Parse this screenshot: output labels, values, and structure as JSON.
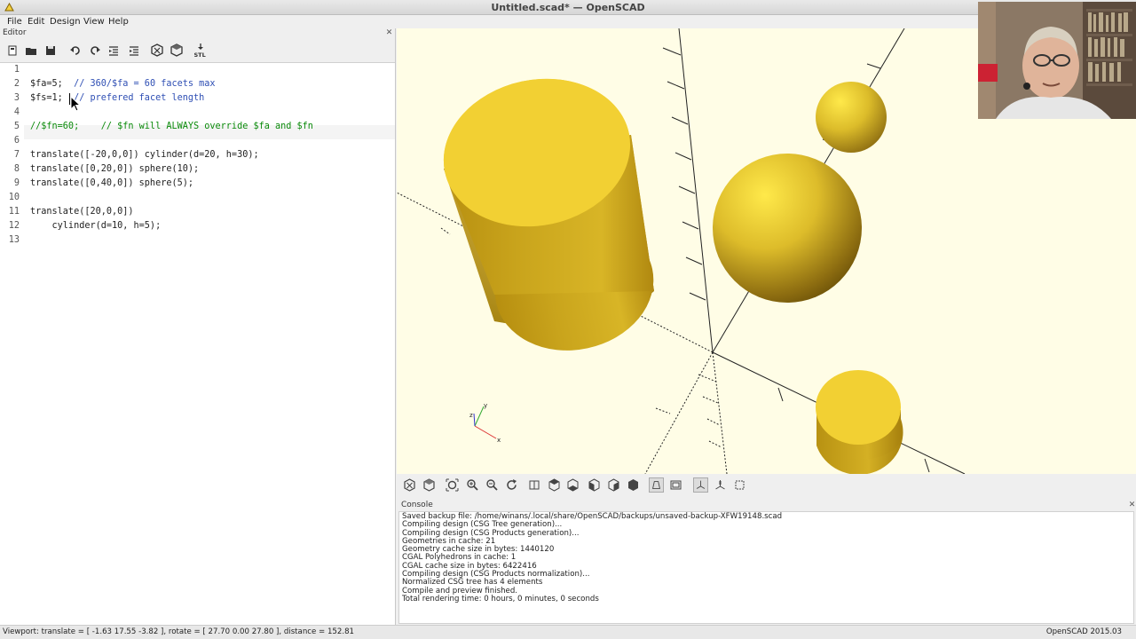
{
  "window": {
    "title": "Untitled.scad* — OpenSCAD"
  },
  "menu": [
    "File",
    "Edit",
    "Design",
    "View",
    "Help"
  ],
  "editor": {
    "dock_title": "Editor",
    "toolbar_icons": [
      "new-file-icon",
      "open-file-icon",
      "save-file-icon",
      "undo-icon",
      "redo-icon",
      "unindent-icon",
      "indent-icon",
      "preview-icon",
      "render-icon",
      "export-stl-icon"
    ],
    "stl_label": "STL",
    "line_numbers": [
      "1",
      "2",
      "3",
      "4",
      "5",
      "6",
      "7",
      "8",
      "9",
      "10",
      "11",
      "12",
      "13"
    ],
    "lines": [
      {
        "code": "",
        "comment": ""
      },
      {
        "code": "$fa=5;  ",
        "comment": "// 360/$fa = 60 facets max"
      },
      {
        "code": "$fs=1;  ",
        "comment": "// prefered facet length"
      },
      {
        "code": "",
        "comment": ""
      },
      {
        "code": "",
        "comment": "//$fn=60;    // $fn will ALWAYS override $fa and $fn"
      },
      {
        "code": "",
        "comment": ""
      },
      {
        "code": "translate([-20,0,0]) cylinder(d=20, h=30);",
        "comment": ""
      },
      {
        "code": "translate([0,20,0]) sphere(10);",
        "comment": ""
      },
      {
        "code": "translate([0,40,0]) sphere(5);",
        "comment": ""
      },
      {
        "code": "",
        "comment": ""
      },
      {
        "code": "translate([20,0,0])",
        "comment": ""
      },
      {
        "code": "    cylinder(d=10, h=5);",
        "comment": ""
      },
      {
        "code": "",
        "comment": ""
      }
    ]
  },
  "viewport": {
    "object_color": "#f0d232",
    "background": "#fffde6",
    "axis_labels": {
      "x": "x",
      "y": "y",
      "z": "z"
    }
  },
  "view_toolbar_icons": [
    "preview-icon",
    "render-icon",
    "view-all-icon",
    "zoom-in-icon",
    "zoom-out-icon",
    "reset-view-icon",
    "view-right-icon",
    "view-top-icon",
    "view-bottom-icon",
    "view-left-icon",
    "view-front-icon",
    "view-back-icon",
    "perspective-icon",
    "orthogonal-icon",
    "show-axes-icon",
    "show-scale-icon",
    "show-edges-icon"
  ],
  "console": {
    "dock_title": "Console",
    "lines": [
      "Saved backup file: /home/winans/.local/share/OpenSCAD/backups/unsaved-backup-XFW19148.scad",
      "Compiling design (CSG Tree generation)...",
      "Compiling design (CSG Products generation)...",
      "Geometries in cache: 21",
      "Geometry cache size in bytes: 1440120",
      "CGAL Polyhedrons in cache: 1",
      "CGAL cache size in bytes: 6422416",
      "Compiling design (CSG Products normalization)...",
      "Normalized CSG tree has 4 elements",
      "Compile and preview finished.",
      "Total rendering time: 0 hours, 0 minutes, 0 seconds"
    ]
  },
  "status": {
    "viewport_info": "Viewport: translate = [ -1.63 17.55 -3.82 ], rotate = [ 27.70 0.00 27.80 ], distance = 152.81",
    "version": "OpenSCAD 2015.03"
  }
}
